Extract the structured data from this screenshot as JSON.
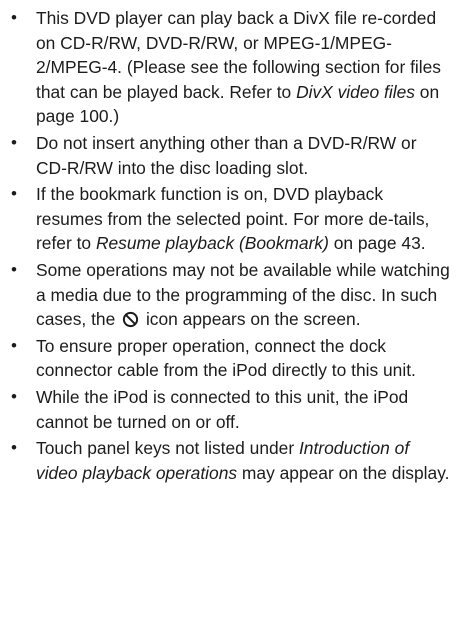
{
  "notes": [
    {
      "parts": [
        "This DVD player can play back a DivX file re-corded on CD-R/RW, DVD-R/RW, or MPEG-1/MPEG-2/MPEG-4. (Please see the following section for files that can be played back. Refer to ",
        "DivX video files",
        " on page 100.)"
      ]
    },
    {
      "text": "Do not insert anything other than a DVD-R/RW or CD-R/RW into the disc loading slot."
    },
    {
      "parts": [
        "If the bookmark function is on, DVD playback resumes from the selected point. For more de-tails, refer to ",
        "Resume playback (Bookmark)",
        " on page 43."
      ]
    },
    {
      "parts": [
        "Some operations may not be available while watching a media due to the programming of the disc. In such cases, the ",
        " icon appears on the screen."
      ],
      "icon": "prohibited-icon"
    },
    {
      "text": "To ensure proper operation, connect the dock connector cable from the iPod directly to this unit."
    },
    {
      "text": "While the iPod is connected to this unit, the iPod cannot be turned on or off."
    },
    {
      "parts": [
        "Touch panel keys not listed under ",
        "Introduction of video playback operations",
        " may appear on the display."
      ]
    }
  ]
}
